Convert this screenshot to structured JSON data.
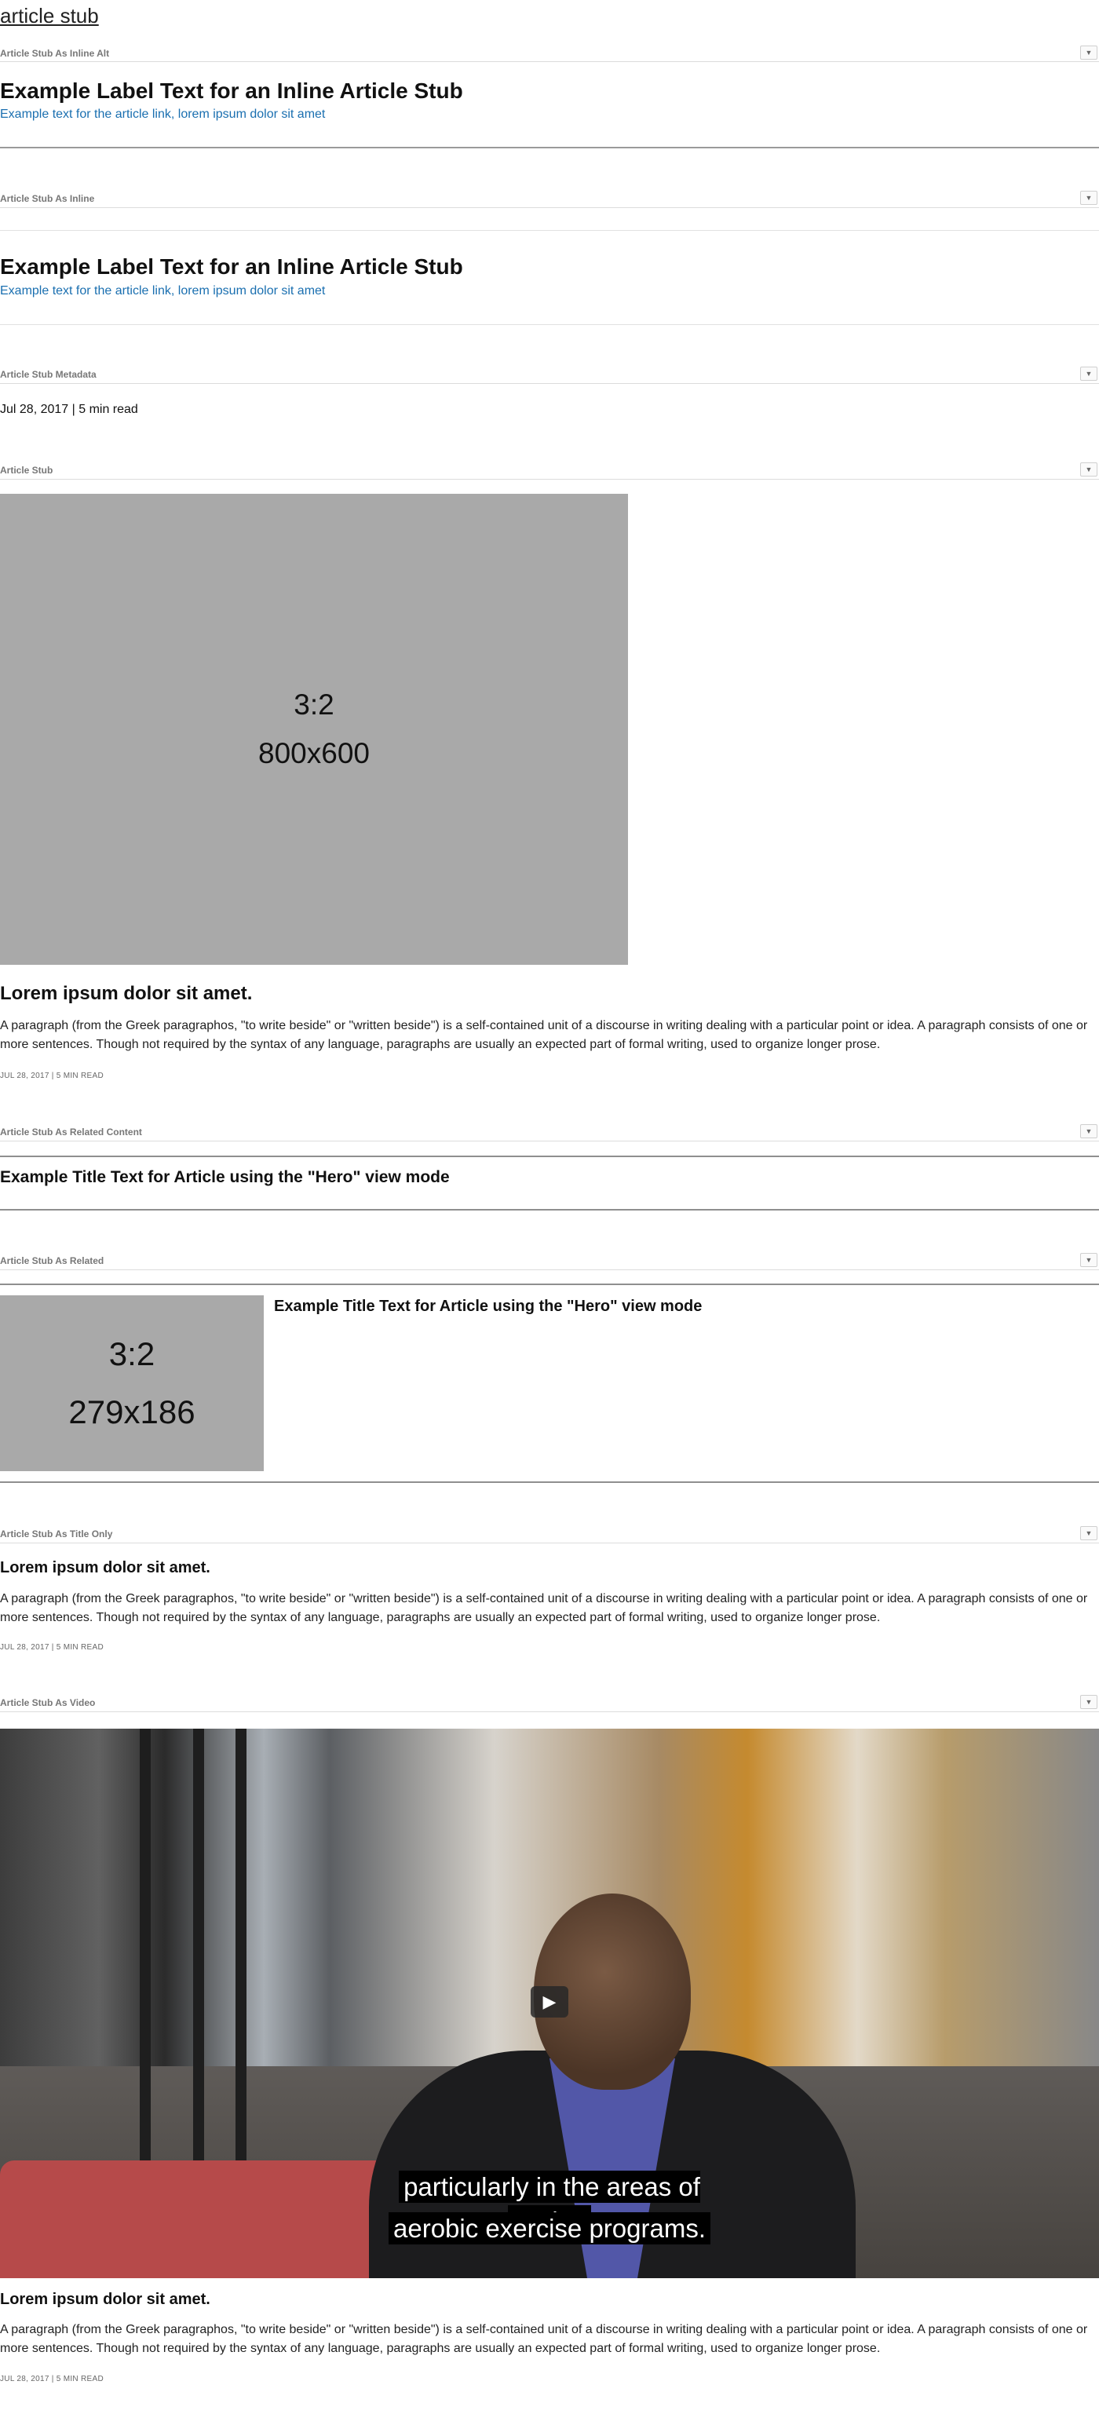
{
  "page": {
    "title": "article stub"
  },
  "toggle_icon": "▼",
  "sections": {
    "inline_alt": {
      "label": "Article Stub As Inline Alt",
      "title": "Example Label Text for an Inline Article Stub",
      "link": "Example text for the article link, lorem ipsum dolor sit amet"
    },
    "inline": {
      "label": "Article Stub As Inline",
      "title": "Example Label Text for an Inline Article Stub",
      "link": "Example text for the article link, lorem ipsum dolor sit amet"
    },
    "metadata": {
      "label": "Article Stub Metadata",
      "text": "Jul 28, 2017 | 5 min read"
    },
    "stub": {
      "label": "Article Stub",
      "image_ratio": "3:2",
      "image_size": "800x600",
      "title": "Lorem ipsum dolor sit amet.",
      "paragraph": "A paragraph (from the Greek paragraphos, \"to write beside\" or \"written beside\") is a self-contained unit of a discourse in writing dealing with a particular point or idea. A paragraph consists of one or more sentences. Though not required by the syntax of any language, paragraphs are usually an expected part of formal writing, used to organize longer prose.",
      "meta": "JUL 28, 2017 | 5 MIN READ"
    },
    "related_content": {
      "label": "Article Stub As Related Content",
      "title": "Example Title Text for Article using the \"Hero\" view mode"
    },
    "related": {
      "label": "Article Stub As Related",
      "image_ratio": "3:2",
      "image_size": "279x186",
      "title": "Example Title Text for Article using the \"Hero\" view mode"
    },
    "title_only": {
      "label": "Article Stub As Title Only",
      "title": "Lorem ipsum dolor sit amet.",
      "paragraph": "A paragraph (from the Greek paragraphos, \"to write beside\" or \"written beside\") is a self-contained unit of a discourse in writing dealing with a particular point or idea. A paragraph consists of one or more sentences. Though not required by the syntax of any language, paragraphs are usually an expected part of formal writing, used to organize longer prose.",
      "meta": "JUL 28, 2017 | 5 MIN READ"
    },
    "video": {
      "label": "Article Stub As Video",
      "caption_line1": "particularly in the areas of routine",
      "caption_line2": "aerobic exercise programs.",
      "title": "Lorem ipsum dolor sit amet.",
      "paragraph": "A paragraph (from the Greek paragraphos, \"to write beside\" or \"written beside\") is a self-contained unit of a discourse in writing dealing with a particular point or idea. A paragraph consists of one or more sentences. Though not required by the syntax of any language, paragraphs are usually an expected part of formal writing, used to organize longer prose.",
      "meta": "JUL 28, 2017 | 5 MIN READ"
    }
  }
}
